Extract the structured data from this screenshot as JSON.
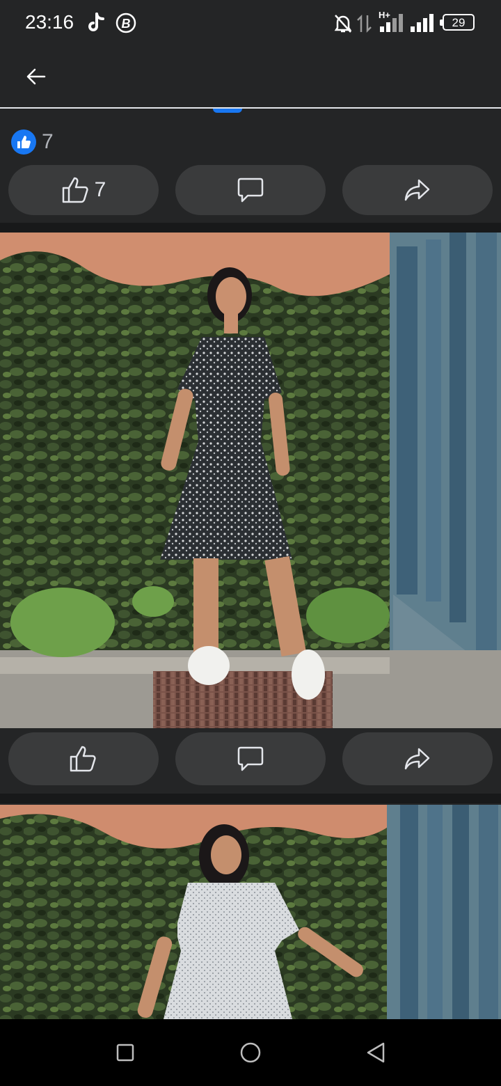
{
  "status_bar": {
    "time": "23:16",
    "battery": "29",
    "icons": [
      "tiktok-icon",
      "b-circle-icon",
      "mute-icon",
      "data-arrows-icon",
      "signal-h-plus-icon",
      "signal-icon",
      "battery-icon"
    ]
  },
  "post": {
    "reaction_count": "7",
    "like_count": "7"
  },
  "photos": [
    {
      "name": "photo-black-floral-dress"
    },
    {
      "name": "photo-white-dotted-dress"
    }
  ],
  "colors": {
    "background": "#242526",
    "button_bg": "#3a3b3c",
    "like_badge": "#1877f2",
    "separator": "#18191a"
  }
}
